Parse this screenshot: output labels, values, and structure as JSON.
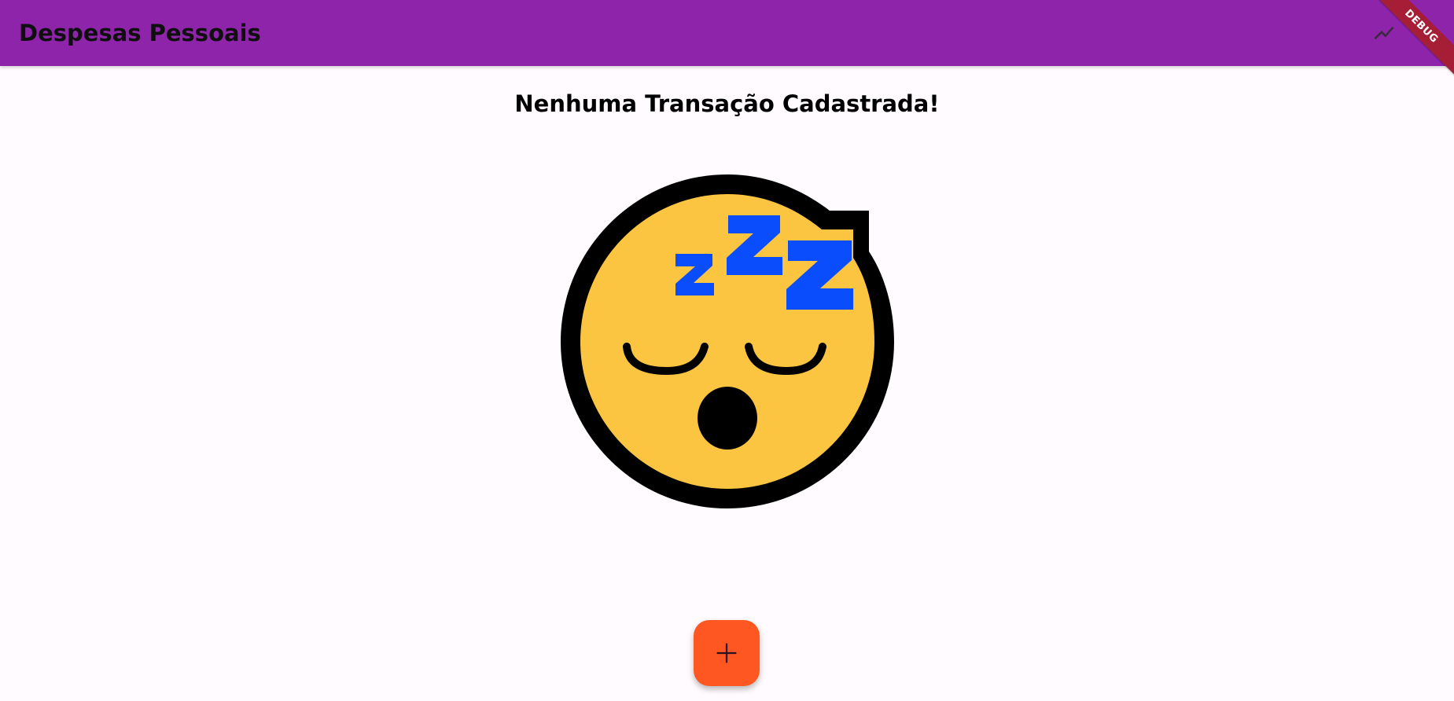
{
  "appbar": {
    "title": "Despesas Pessoais",
    "background_color": "#8e24aa",
    "action_icon": "show-chart-icon"
  },
  "debug_banner": {
    "label": "DEBUG",
    "color": "#a51e36"
  },
  "empty_state": {
    "message": "Nenhuma Transação Cadastrada!",
    "image_icon": "sleeping-face-emoji"
  },
  "fab": {
    "icon": "plus-icon",
    "color": "#ff5722"
  }
}
